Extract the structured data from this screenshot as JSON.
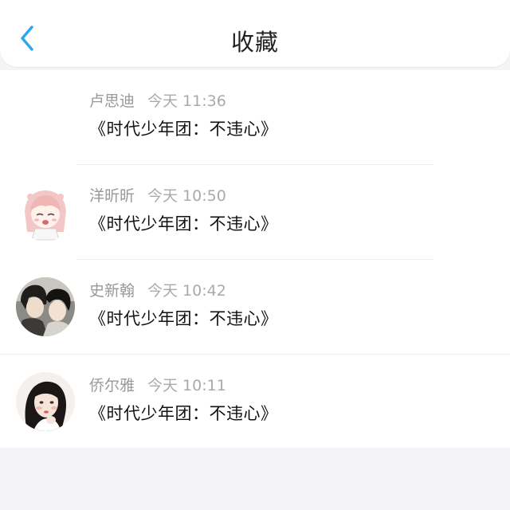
{
  "header": {
    "title": "收藏",
    "back_icon": "chevron-left-icon",
    "accent_color": "#2fa5ea"
  },
  "favorites": [
    {
      "name": "卢思迪",
      "time": "今天 11:36",
      "message": "《时代少年团：不违心》",
      "avatar": "none"
    },
    {
      "name": "洋昕昕",
      "time": "今天 10:50",
      "message": "《时代少年团：不违心》",
      "avatar": "anime-girl-avatar"
    },
    {
      "name": "史新翰",
      "time": "今天 10:42",
      "message": "《时代少年团：不违心》",
      "avatar": "couple-photo-avatar"
    },
    {
      "name": "侨尔雅",
      "time": "今天 10:11",
      "message": "《时代少年团：不违心》",
      "avatar": "illustrated-girl-avatar"
    }
  ]
}
